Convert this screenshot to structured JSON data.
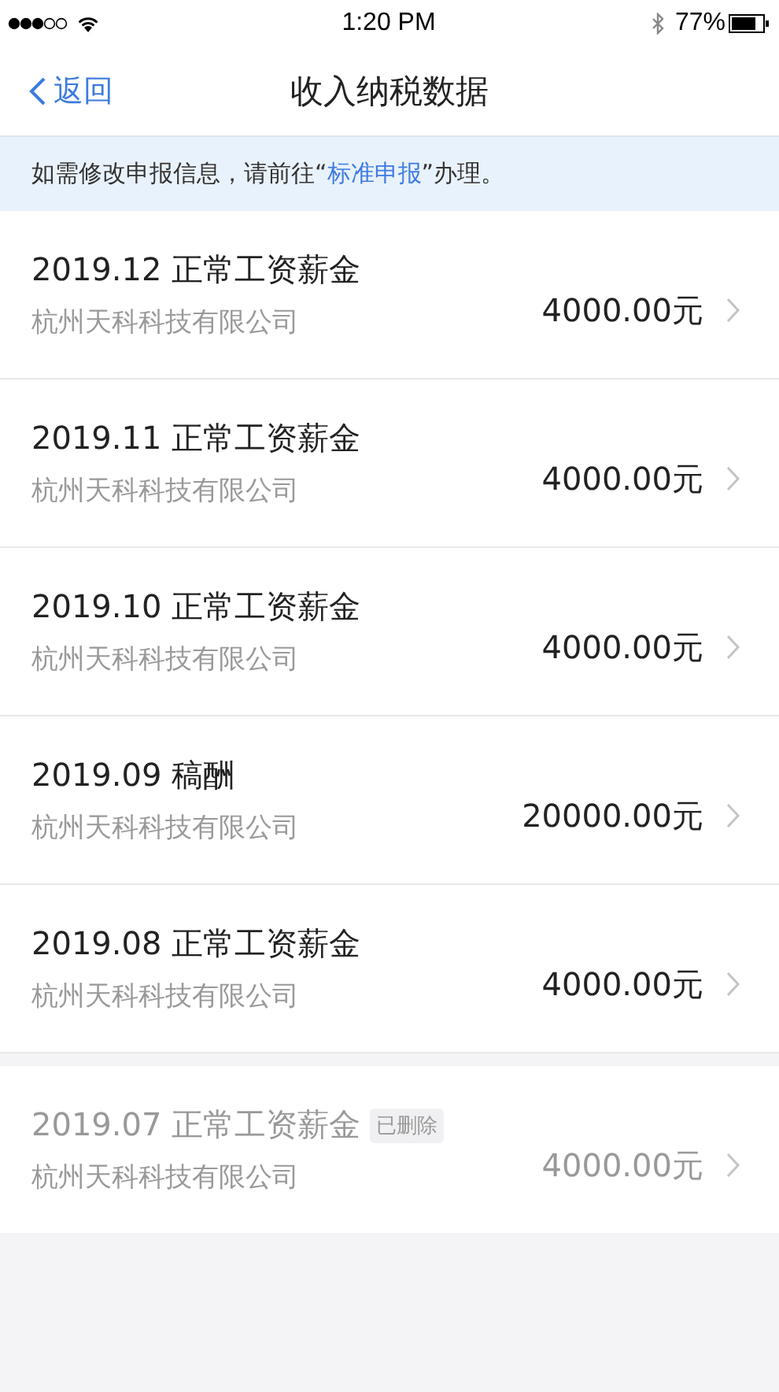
{
  "status_bar": {
    "time": "1:20 PM",
    "battery": "77%"
  },
  "nav": {
    "back": "返回",
    "title": "收入纳税数据"
  },
  "notice": {
    "before": "如需修改申报信息，请前往“",
    "link": "标准申报",
    "after": "”办理。"
  },
  "records": [
    {
      "title": "2019.12 正常工资薪金",
      "company": "杭州天科科技有限公司",
      "amount": "4000.00元",
      "deleted": false
    },
    {
      "title": "2019.11 正常工资薪金",
      "company": "杭州天科科技有限公司",
      "amount": "4000.00元",
      "deleted": false
    },
    {
      "title": "2019.10 正常工资薪金",
      "company": "杭州天科科技有限公司",
      "amount": "4000.00元",
      "deleted": false
    },
    {
      "title": "2019.09 稿酬",
      "company": "杭州天科科技有限公司",
      "amount": "20000.00元",
      "deleted": false
    },
    {
      "title": "2019.08 正常工资薪金",
      "company": "杭州天科科技有限公司",
      "amount": "4000.00元",
      "deleted": false
    },
    {
      "title": "2019.07 正常工资薪金",
      "company": "杭州天科科技有限公司",
      "amount": "4000.00元",
      "deleted": true,
      "badge": "已删除"
    }
  ]
}
